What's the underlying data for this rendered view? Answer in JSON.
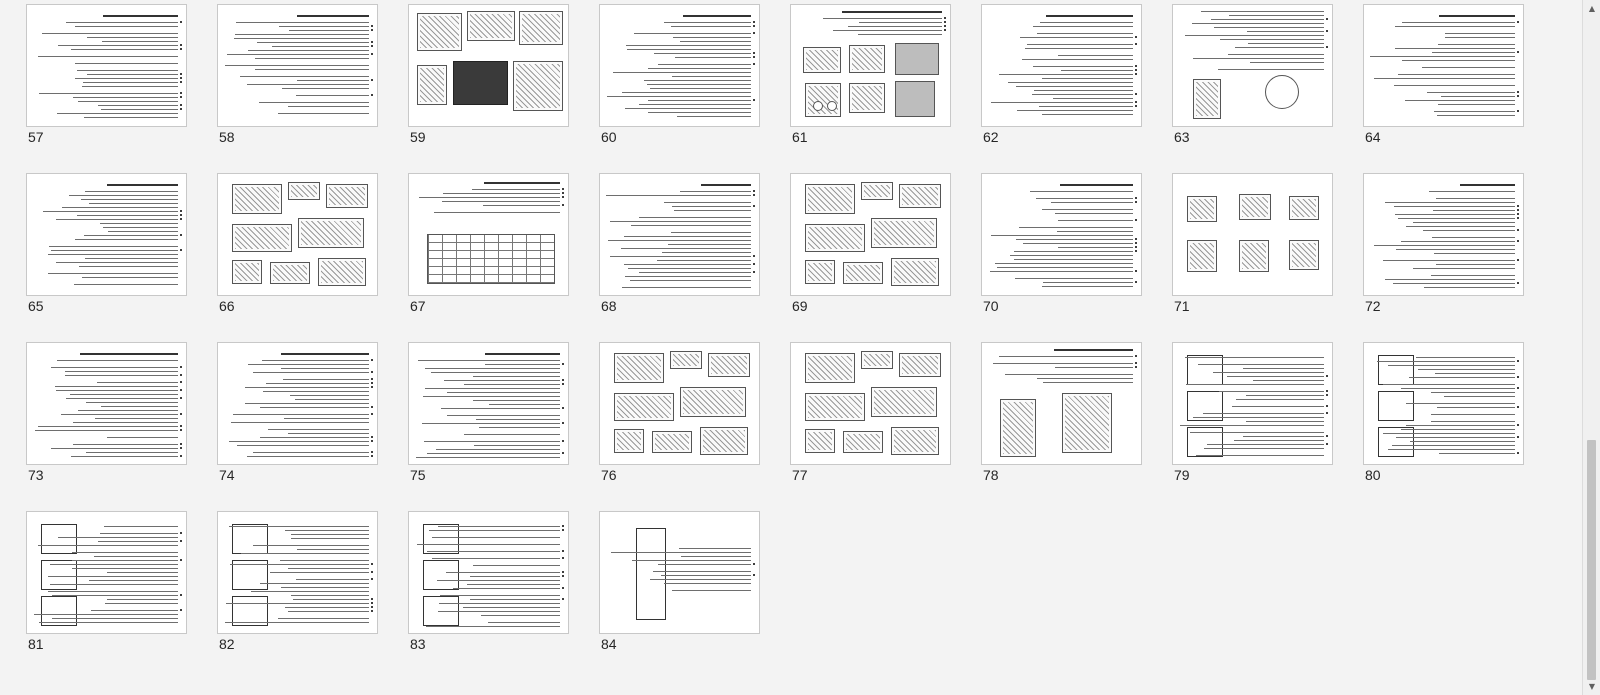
{
  "slide_sorter": {
    "slides": [
      {
        "number": "57",
        "layout": "text"
      },
      {
        "number": "58",
        "layout": "text"
      },
      {
        "number": "59",
        "layout": "photos"
      },
      {
        "number": "60",
        "layout": "text"
      },
      {
        "number": "61",
        "layout": "photos-grid"
      },
      {
        "number": "62",
        "layout": "text"
      },
      {
        "number": "63",
        "layout": "text-figs"
      },
      {
        "number": "64",
        "layout": "text"
      },
      {
        "number": "65",
        "layout": "text"
      },
      {
        "number": "66",
        "layout": "diagram"
      },
      {
        "number": "67",
        "layout": "text-table"
      },
      {
        "number": "68",
        "layout": "text"
      },
      {
        "number": "69",
        "layout": "diagram"
      },
      {
        "number": "70",
        "layout": "text"
      },
      {
        "number": "71",
        "layout": "diagram-sparse"
      },
      {
        "number": "72",
        "layout": "text"
      },
      {
        "number": "73",
        "layout": "text"
      },
      {
        "number": "74",
        "layout": "text"
      },
      {
        "number": "75",
        "layout": "text"
      },
      {
        "number": "76",
        "layout": "diagram"
      },
      {
        "number": "77",
        "layout": "diagram"
      },
      {
        "number": "78",
        "layout": "text-diagram"
      },
      {
        "number": "79",
        "layout": "scan"
      },
      {
        "number": "80",
        "layout": "scan"
      },
      {
        "number": "81",
        "layout": "scan"
      },
      {
        "number": "82",
        "layout": "scan"
      },
      {
        "number": "83",
        "layout": "scan"
      },
      {
        "number": "84",
        "layout": "scan-narrow"
      }
    ]
  },
  "scrollbar": {
    "up_arrow": "▲",
    "down_arrow": "▼"
  }
}
